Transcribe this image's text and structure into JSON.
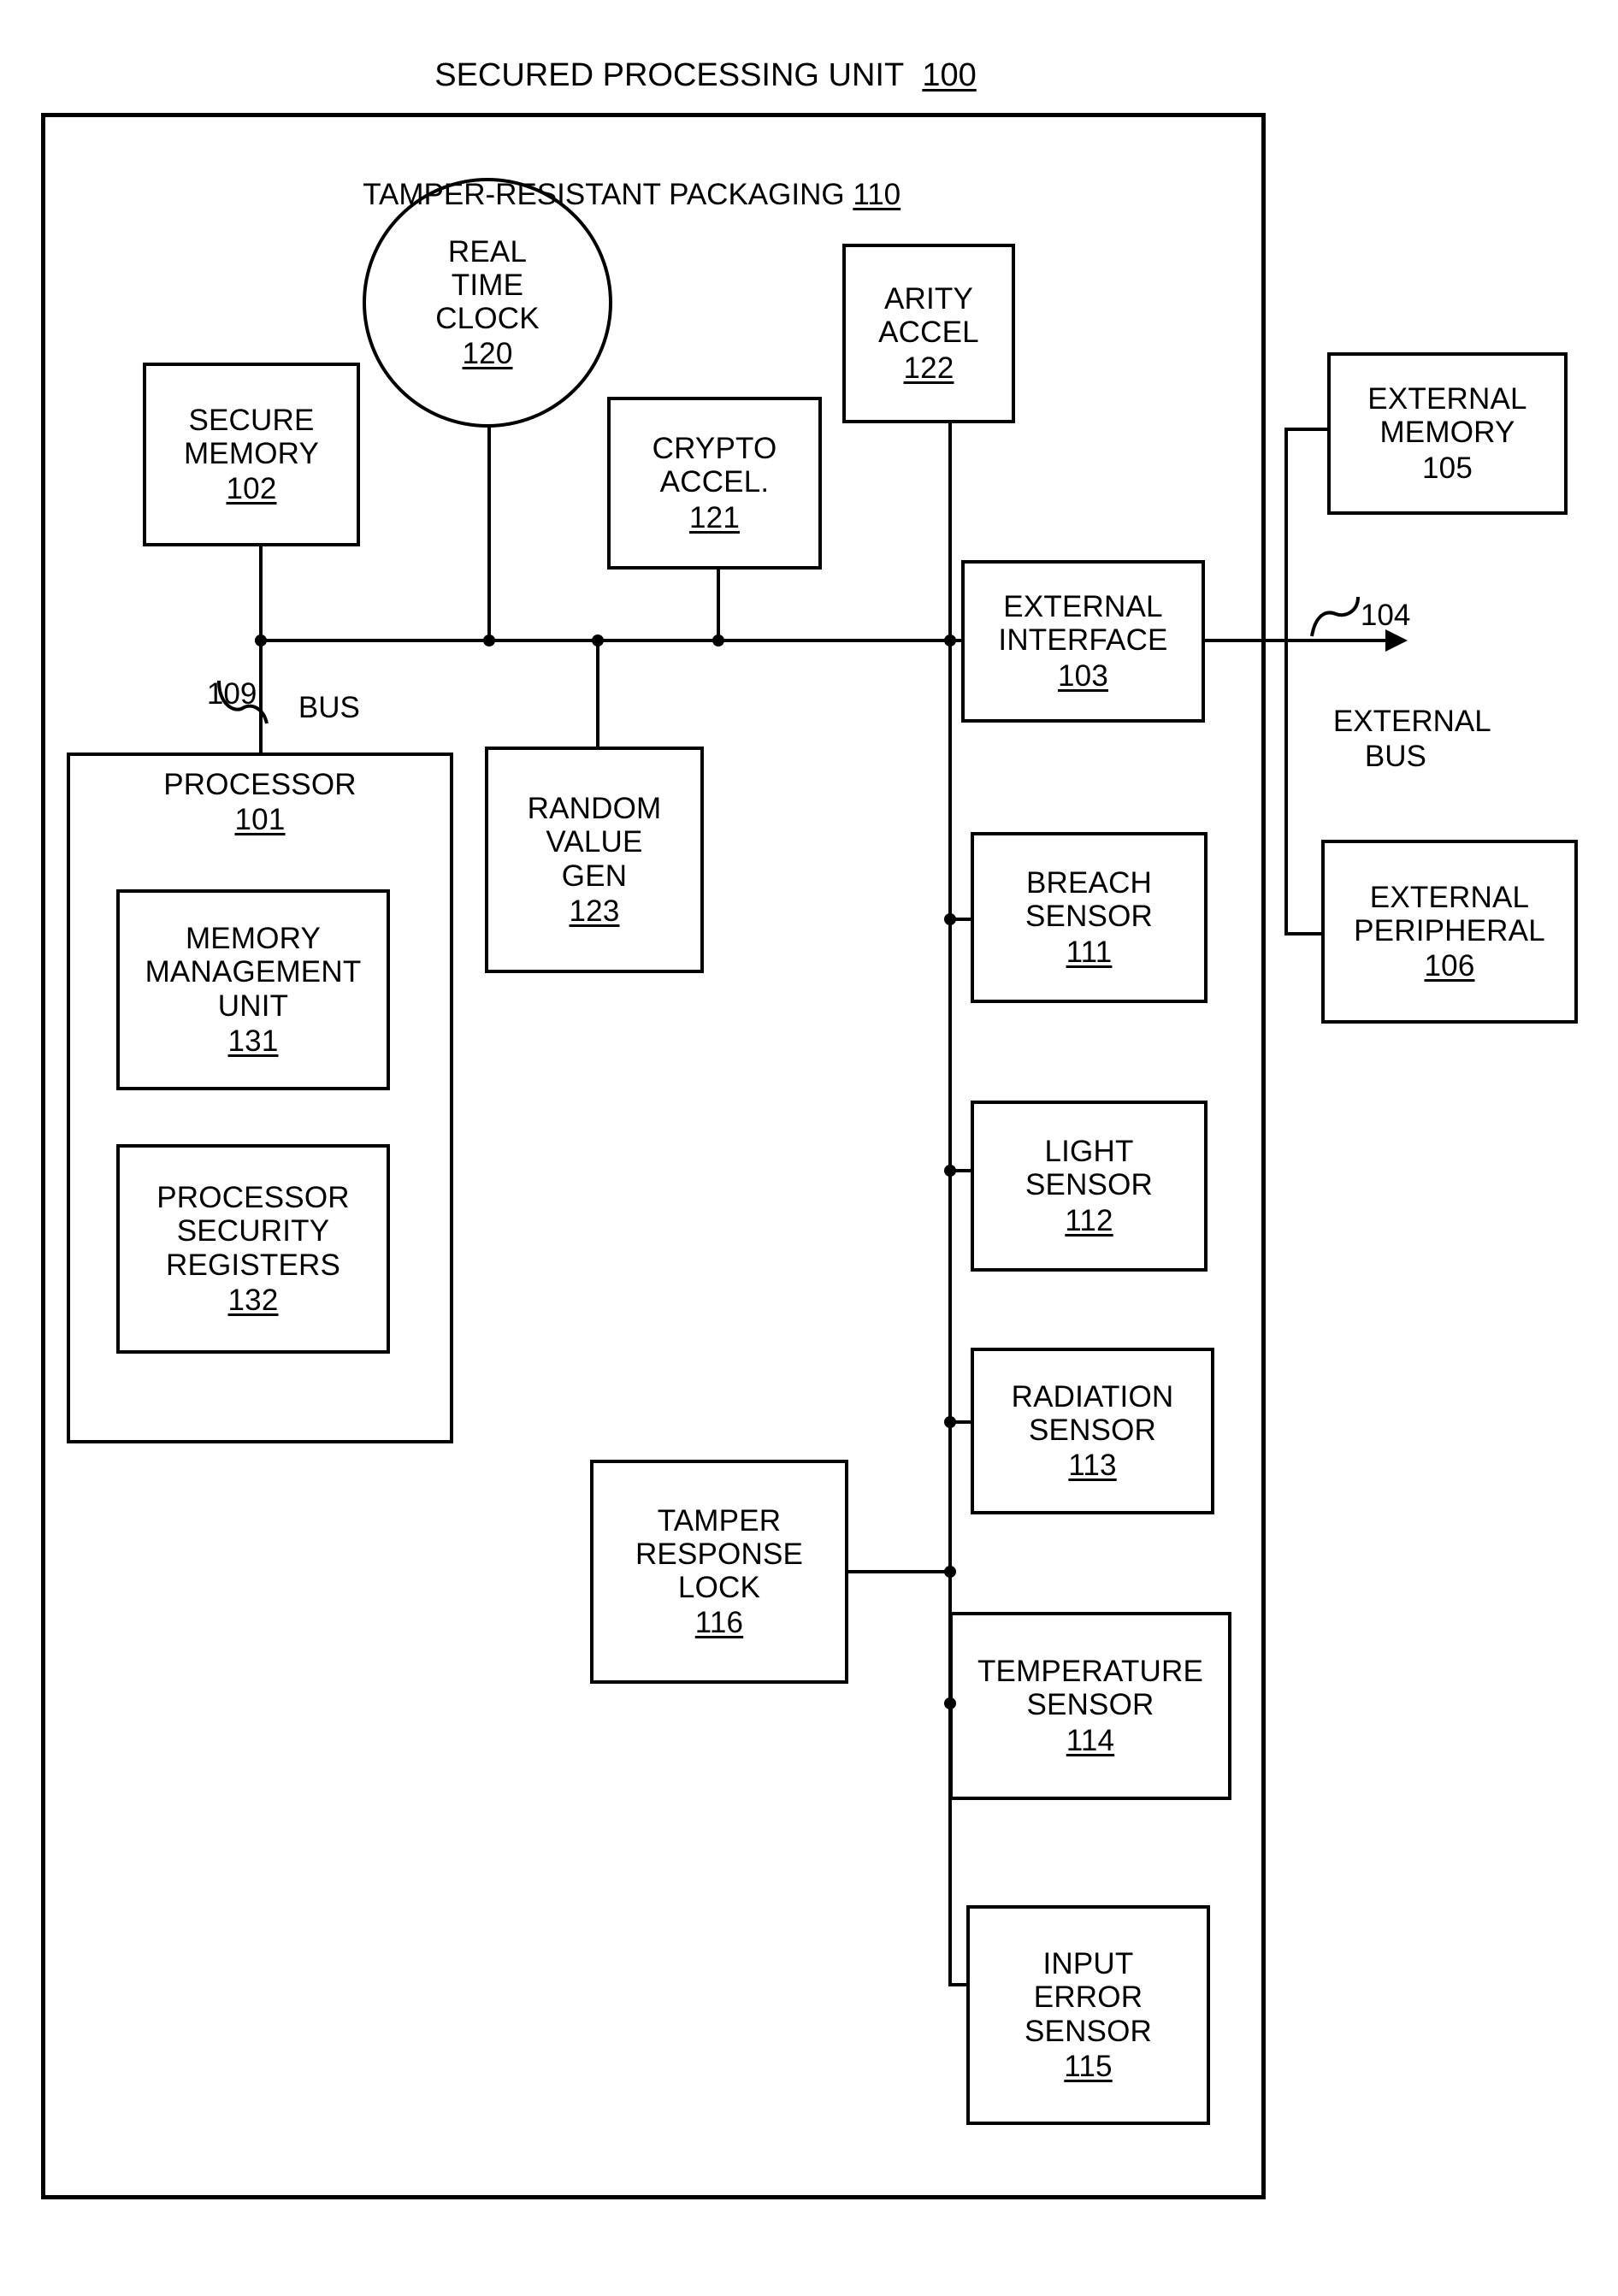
{
  "figure": {
    "title_label": "SECURED PROCESSING UNIT",
    "title_ref": "100",
    "enclosure_label": "TAMPER-RESISTANT PACKAGING",
    "enclosure_ref": "110"
  },
  "bus": {
    "ref": "109",
    "label": "BUS"
  },
  "external_bus": {
    "ref": "104",
    "label": "EXTERNAL\nBUS"
  },
  "nodes": {
    "secure_memory": {
      "label": "SECURE\nMEMORY",
      "ref": "102"
    },
    "real_time_clock": {
      "label": "REAL\nTIME\nCLOCK",
      "ref": "120"
    },
    "crypto_accel": {
      "label": "CRYPTO\nACCEL.",
      "ref": "121"
    },
    "arity_accel": {
      "label": "ARITY\nACCEL",
      "ref": "122"
    },
    "external_interface": {
      "label": "EXTERNAL\nINTERFACE",
      "ref": "103"
    },
    "processor": {
      "label": "PROCESSOR",
      "ref": "101"
    },
    "mmu": {
      "label": "MEMORY\nMANAGEMENT\nUNIT",
      "ref": "131"
    },
    "psr": {
      "label": "PROCESSOR\nSECURITY\nREGISTERS",
      "ref": "132"
    },
    "random_value_gen": {
      "label": "RANDOM\nVALUE\nGEN",
      "ref": "123"
    },
    "tamper_response_lock": {
      "label": "TAMPER\nRESPONSE\nLOCK",
      "ref": "116"
    },
    "breach_sensor": {
      "label": "BREACH\nSENSOR",
      "ref": "111"
    },
    "light_sensor": {
      "label": "LIGHT\nSENSOR",
      "ref": "112"
    },
    "radiation_sensor": {
      "label": "RADIATION\nSENSOR",
      "ref": "113"
    },
    "temperature_sensor": {
      "label": "TEMPERATURE\nSENSOR",
      "ref": "114"
    },
    "input_error_sensor": {
      "label": "INPUT\nERROR\nSENSOR",
      "ref": "115"
    },
    "external_memory": {
      "label": "EXTERNAL\nMEMORY",
      "ref": "105"
    },
    "external_peripheral": {
      "label": "EXTERNAL\nPERIPHERAL",
      "ref": "106"
    }
  }
}
